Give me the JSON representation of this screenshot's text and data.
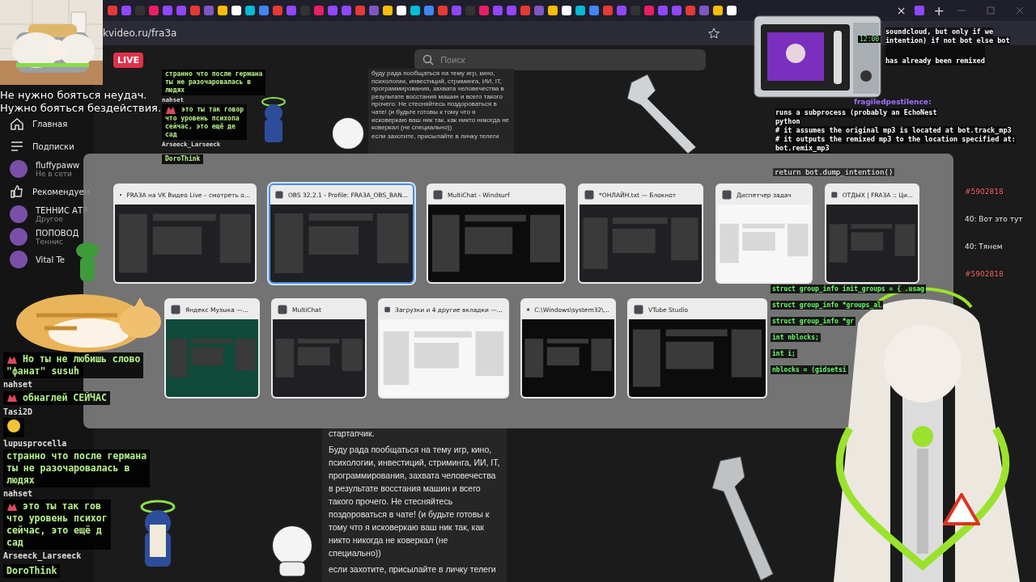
{
  "browser": {
    "tab_close": "×",
    "new_tab": "+",
    "address": "kvideo.ru/fra3a"
  },
  "quote": [
    "Не нужно бояться неудач.",
    "Нужно бояться бездействия."
  ],
  "site": {
    "live_badge": "LIVE",
    "search": {
      "placeholder": "Поиск"
    },
    "sidebar": [
      {
        "kind": "home",
        "label": "Главная"
      },
      {
        "kind": "subs",
        "label": "Подписки"
      },
      {
        "kind": "channel",
        "label": "fluffypaww",
        "sub": "Не в сети"
      },
      {
        "kind": "likes",
        "label": "Рекомендуем"
      },
      {
        "kind": "channel",
        "label": "ТЕННИС АТР",
        "sub": "Другое"
      },
      {
        "kind": "channel",
        "label": "ПОПОВОД",
        "sub": "Теннис"
      },
      {
        "kind": "channel",
        "label": "Vital Te"
      }
    ],
    "about": [
      "стартапчик.",
      "Буду рада пообщаться на тему игр, кино, психологии, инвестиций, стриминга, ИИ, IT, программирования, захвата человечества в результате восстания машин и всего такого прочего. Не стесняйтесь поздороваться в чате! (и будьте готовы к тому что я исковеркаю ваш ник так, как никто никогда не коверкал (не специально))",
      "если захотите, присылайте в личку телеги"
    ],
    "about_mirror": [
      "буду рада пообщаться на тему игр, кино, психологии, инвестиций, стриминга, ИИ, IT, программирования, захвата человечества в результате восстания машин и всего такого прочего. Не стесняйтесь поздороваться в чате! (и будьте готовы к тому что я исковеркаю ваш ник так, как никто никогда не коверкал (не специально))",
      "если захотите, присылайте в личку телеги"
    ]
  },
  "task_switcher": {
    "upper_windows": [
      {
        "title": "FRA3A на VK Видео Live – смотреть о...",
        "kind": "dark",
        "selected": false
      },
      {
        "title": "OBS 32.2.1 - Profile: FRA3A_OBS_BAN...",
        "kind": "dark",
        "selected": true
      },
      {
        "title": "MultiChat - Windsurf",
        "kind": "black",
        "selected": false
      },
      {
        "title": "*ОНЛАЙН.txt — Блокнот",
        "kind": "dark",
        "selected": false
      },
      {
        "title": "Диспетчер задач",
        "kind": "light",
        "selected": false
      },
      {
        "title": "ОТДЫХ | FRA3A :: Ци...",
        "kind": "dark",
        "selected": false
      }
    ],
    "lower_windows": [
      {
        "title": "Яндекс Музыка —...",
        "kind": "green",
        "selected": false
      },
      {
        "title": "MultiChat",
        "kind": "dark",
        "selected": false
      },
      {
        "title": "Загрузки и 4 другие вкладки —...",
        "kind": "light",
        "selected": false
      },
      {
        "title": "C:\\Windows\\system32\\...",
        "kind": "black",
        "selected": false
      },
      {
        "title": "VTube Studio",
        "kind": "black",
        "selected": false
      }
    ]
  },
  "chat": [
    {
      "emote": true,
      "lines": [
        "Но ты не любишь слово",
        "\"фанат\" susuh"
      ]
    },
    {
      "user": "nahset",
      "emote": true,
      "lines": [
        "обнаглей СЕЙЧАС"
      ]
    },
    {
      "user": "Tasi2D",
      "kind": "emoji"
    },
    {
      "user": "lupusprocella",
      "emote": false,
      "lines": [
        "странно что после германа",
        "ты не разочаровалась в",
        "людях"
      ]
    },
    {
      "user": "nahset",
      "emote": true,
      "lines": [
        "это ты так гов",
        "что уровень психог",
        "сейчас, это ещё д",
        "сад"
      ]
    },
    {
      "user": "Arseeck_Larseeck",
      "emote": false,
      "lines": [
        "DoroThink"
      ]
    }
  ],
  "chat_mirror": [
    {
      "emote": false,
      "lines": [
        "странно что после германа",
        "ты не разочаровалась в",
        "людях"
      ]
    },
    {
      "user": "nahset",
      "emote": true,
      "lines": [
        "это ты так говор",
        "что уровень психопа",
        "сейчас, это ещё де",
        "сад"
      ]
    },
    {
      "user": "Arseeck_Larseeck",
      "emote": false,
      "lines": [
        "DoroThink"
      ]
    }
  ],
  "microwave": {
    "display": "12:00"
  },
  "code_top": [
    "soundcloud, but only if we",
    "intention) if not bot else bot",
    "has already been remixed"
  ],
  "chat_user_right": "fragiledpestilence:",
  "code_mid": [
    "runs a subprocess (probably an EchoNest",
    "python",
    "# it assumes the original mp3 is located at bot.track_mp3",
    "# it outputs the remixed mp3 to the location specified at:",
    "bot.remix_mp3"
  ],
  "code_return": "return bot.dump_intention()",
  "right_chat": [
    "#5902818",
    "40: Вот это тут",
    "40: Тянем",
    "#5902818"
  ],
  "code_bottom": [
    "struct group_info init_groups = { .usag",
    "struct group_info *groups_al",
    "struct group_info *gr",
    "int nblocks;",
    "int i;",
    "nblocks = (gidsetsi"
  ]
}
